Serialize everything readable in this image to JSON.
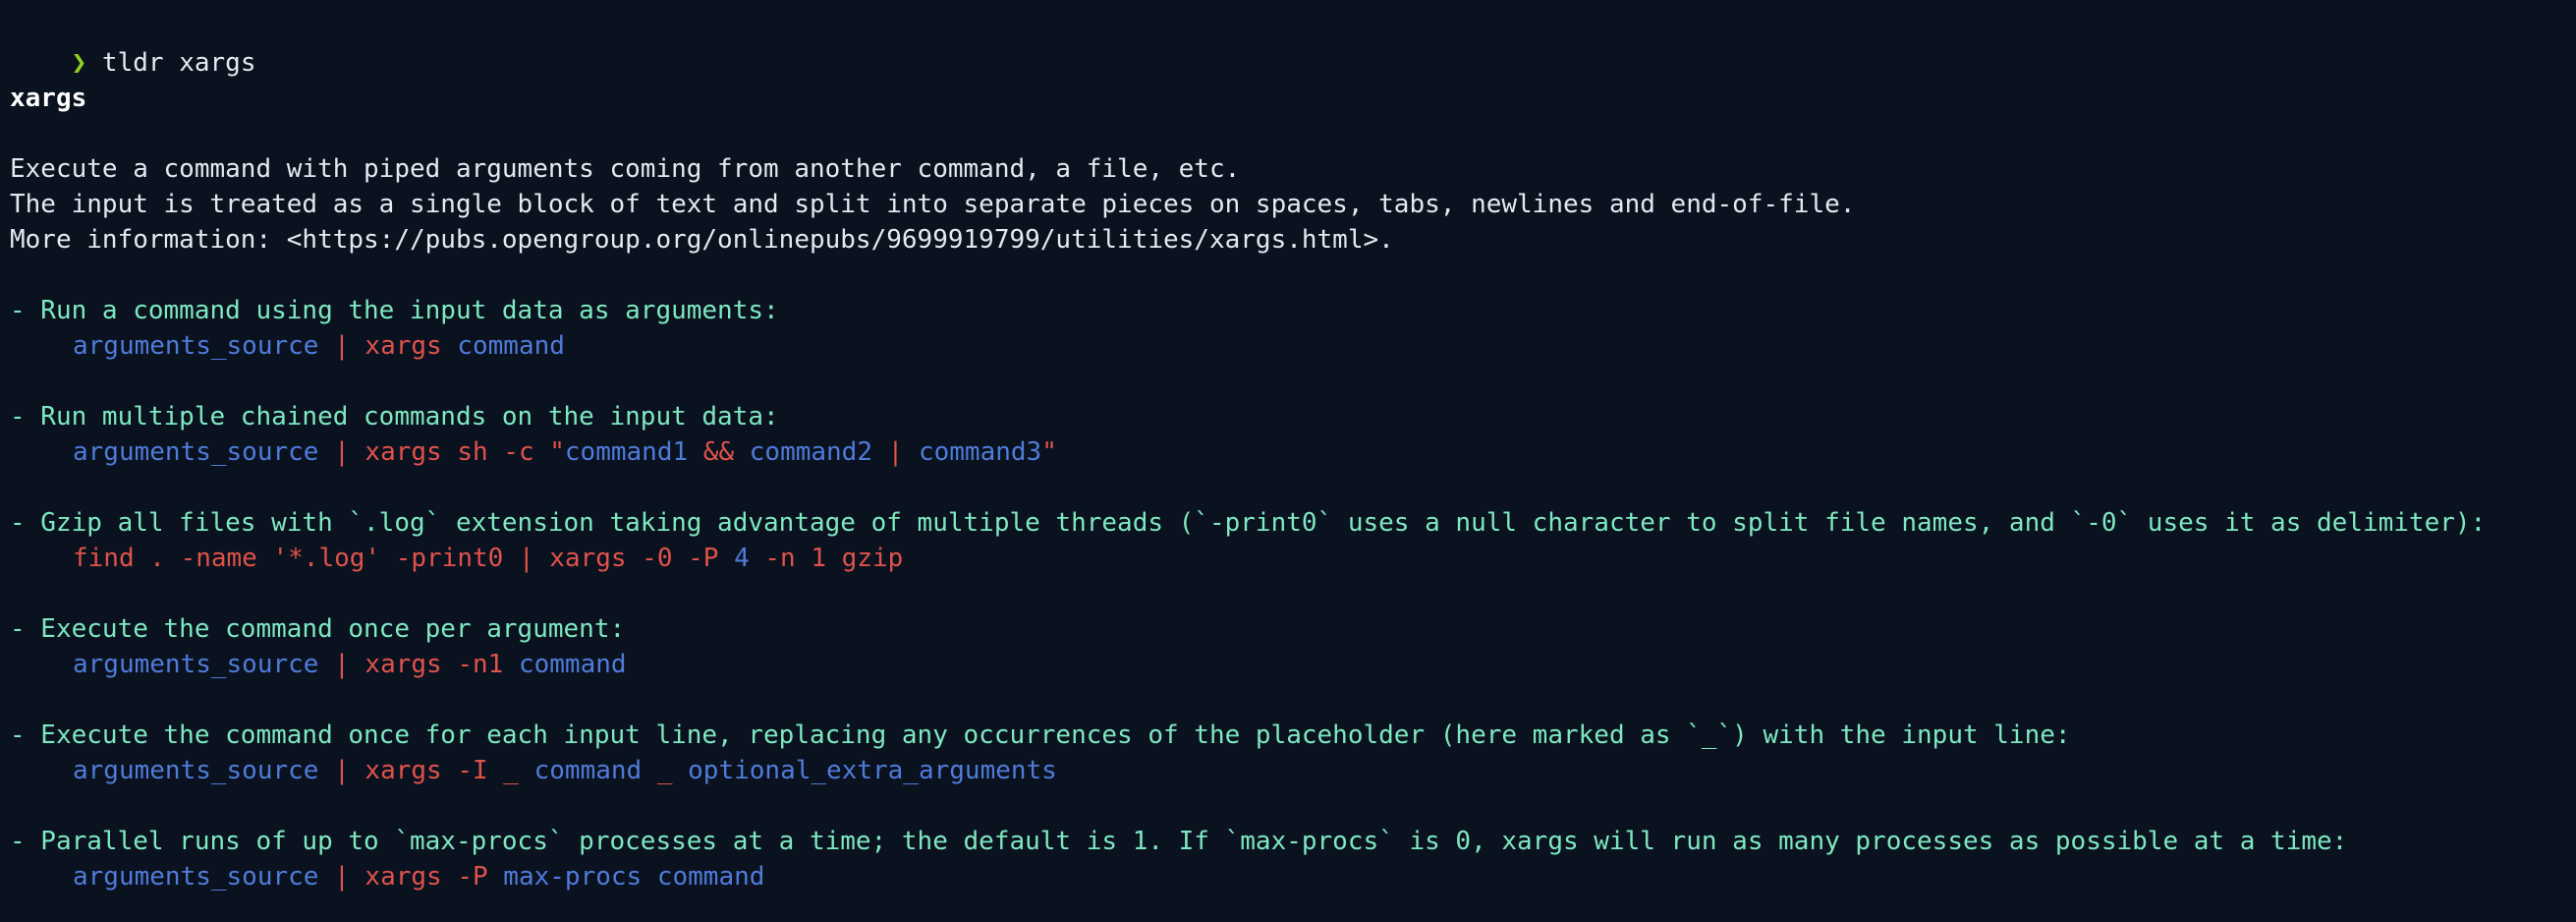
{
  "prompt": {
    "symbol": "❯",
    "command": " tldr xargs"
  },
  "page": {
    "title": "xargs",
    "description": [
      "Execute a command with piped arguments coming from another command, a file, etc.",
      "The input is treated as a single block of text and split into separate pieces on spaces, tabs, newlines and end-of-file.",
      "More information: <https://pubs.opengroup.org/onlinepubs/9699919799/utilities/xargs.html>."
    ]
  },
  "examples": [
    {
      "description": "- Run a command using the input data as arguments:",
      "tokens": [
        {
          "t": "arguments_source",
          "k": "placeholder"
        },
        {
          "t": " | xargs ",
          "k": "literal"
        },
        {
          "t": "command",
          "k": "placeholder"
        }
      ]
    },
    {
      "description": "- Run multiple chained commands on the input data:",
      "tokens": [
        {
          "t": "arguments_source",
          "k": "placeholder"
        },
        {
          "t": " | xargs sh -c \"",
          "k": "literal"
        },
        {
          "t": "command1",
          "k": "placeholder"
        },
        {
          "t": " && ",
          "k": "literal"
        },
        {
          "t": "command2",
          "k": "placeholder"
        },
        {
          "t": " | ",
          "k": "literal"
        },
        {
          "t": "command3",
          "k": "placeholder"
        },
        {
          "t": "\"",
          "k": "literal"
        }
      ]
    },
    {
      "description": "- Gzip all files with `.log` extension taking advantage of multiple threads (`-print0` uses a null character to split file names, and `-0` uses it as delimiter):",
      "tokens": [
        {
          "t": "find . -name '*.log' -print0 | xargs -0 -P ",
          "k": "literal"
        },
        {
          "t": "4",
          "k": "placeholder"
        },
        {
          "t": " -n 1 gzip",
          "k": "literal"
        }
      ]
    },
    {
      "description": "- Execute the command once per argument:",
      "tokens": [
        {
          "t": "arguments_source",
          "k": "placeholder"
        },
        {
          "t": " | xargs -n1 ",
          "k": "literal"
        },
        {
          "t": "command",
          "k": "placeholder"
        }
      ]
    },
    {
      "description": "- Execute the command once for each input line, replacing any occurrences of the placeholder (here marked as `_`) with the input line:",
      "tokens": [
        {
          "t": "arguments_source",
          "k": "placeholder"
        },
        {
          "t": " | xargs -I _ ",
          "k": "literal"
        },
        {
          "t": "command",
          "k": "placeholder"
        },
        {
          "t": " _ ",
          "k": "literal"
        },
        {
          "t": "optional_extra_arguments",
          "k": "placeholder"
        }
      ]
    },
    {
      "description": "- Parallel runs of up to `max-procs` processes at a time; the default is 1. If `max-procs` is 0, xargs will run as many processes as possible at a time:",
      "tokens": [
        {
          "t": "arguments_source",
          "k": "placeholder"
        },
        {
          "t": " | xargs -P ",
          "k": "literal"
        },
        {
          "t": "max-procs",
          "k": "placeholder"
        },
        {
          "t": " ",
          "k": "literal"
        },
        {
          "t": "command",
          "k": "placeholder"
        }
      ]
    }
  ],
  "colors": {
    "background": "#0a1220",
    "prompt": "#8fd11f",
    "example_description": "#7ee8c0",
    "placeholder": "#4f7bd9",
    "literal": "#e0524a"
  }
}
